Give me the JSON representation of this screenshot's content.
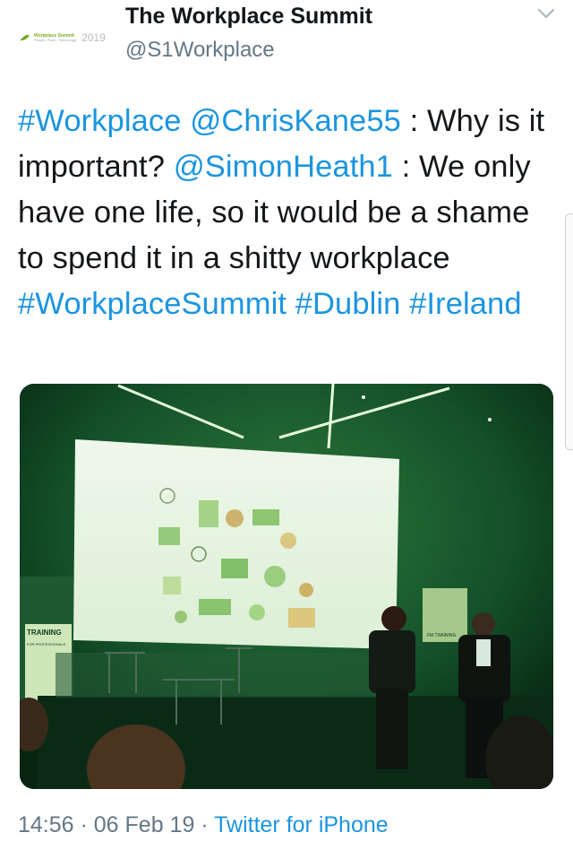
{
  "profile": {
    "name": "The Workplace Summit",
    "handle": "@S1Workplace",
    "avatar_title": "Workplace Summit",
    "avatar_tagline": "People, Place, Technology",
    "avatar_year": "2019"
  },
  "tweet": {
    "hashtag_workplace": "#Workplace",
    "mention_chriskane": "@ChrisKane55",
    "text_1": " : Why is it important? ",
    "mention_simonheath": "@SimonHeath1",
    "text_2": " : We only have one life, so it would be a shame to spend it in a shitty workplace ",
    "hashtag_summit": "#WorkplaceSummit",
    "hashtag_dublin": "#Dublin",
    "text_3": " ",
    "hashtag_ireland": "#Ireland"
  },
  "media": {
    "banner_left": "TRAINING",
    "banner_left_sub": "FOR PROFESSIONALS",
    "banner_right": "FM TRAINING"
  },
  "meta": {
    "time": "14:56",
    "sep1": " · ",
    "date": "06 Feb 19",
    "sep2": " · ",
    "source": "Twitter for iPhone"
  },
  "colors": {
    "link": "#1b95e0",
    "secondary_text": "#657786",
    "primary_text": "#14171a"
  },
  "icons": {
    "caret": "chevron-down-icon",
    "avatar": "summit-logo"
  }
}
